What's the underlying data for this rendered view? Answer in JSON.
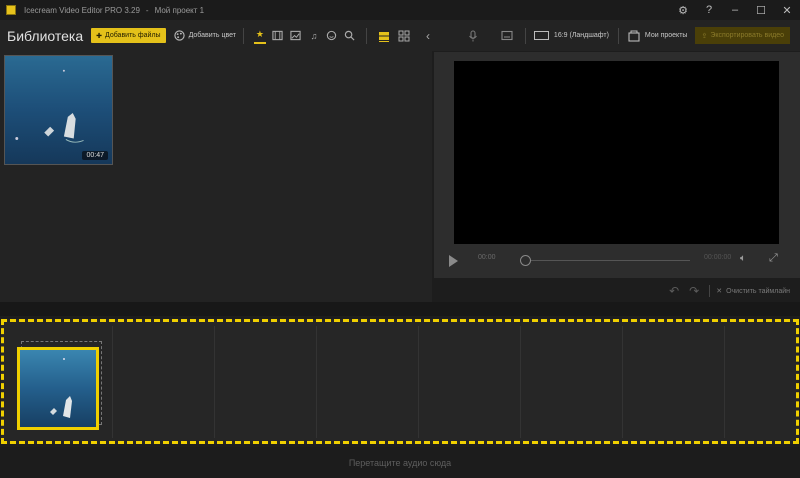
{
  "window": {
    "app_title": "Icecream Video Editor PRO 3.29",
    "separator": "-",
    "project_name": "Мой проект 1",
    "controls": [
      "gear-icon",
      "help-icon",
      "minimize-icon",
      "maximize-icon",
      "close-icon"
    ]
  },
  "toolbar": {
    "library_title": "Библиотека",
    "add_files": "Добавить файлы",
    "add_color": "Добавить цвет",
    "filter_icons": [
      "star-icon",
      "video-icon",
      "image-icon",
      "music-icon",
      "sticker-icon",
      "search-icon"
    ],
    "view_icons": [
      "list-view-icon",
      "grid-view-icon"
    ],
    "ratio": "16:9 (Ландшафт)",
    "my_projects": "Мои проекты",
    "export": "Экспортировать видео"
  },
  "library": {
    "items": [
      {
        "duration": "00:47"
      }
    ]
  },
  "preview": {
    "current_time": "00:00",
    "total_time": "00:00:00",
    "progress": 0
  },
  "edit": {
    "clear_timeline": "Очистить таймлайн"
  },
  "timeline": {
    "clips": 1
  },
  "audio": {
    "hint": "Перетащите аудио сюда"
  },
  "colors": {
    "accent": "#f0d000",
    "background": "#1e1e1e",
    "panel": "#232323"
  }
}
